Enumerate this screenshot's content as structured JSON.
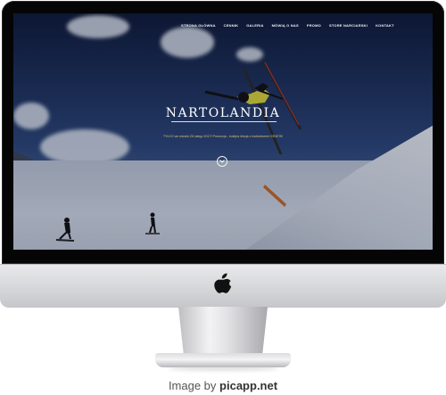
{
  "website": {
    "nav": [
      "STRONA GŁÓWNA",
      "CENNIK",
      "GALERIA",
      "MÓWIĄ O NAS",
      "PROMO",
      "STORE NARCIARSKI",
      "KONTAKT"
    ],
    "title": "NARTOLANDIA",
    "tagline": "TYLKO we wtorek 26 lutego 2017! Promocja - kolejna lekcja z instruktorem GRATIS!"
  },
  "credit": {
    "prefix": "Image by",
    "brand": "picapp.net"
  },
  "icons": {
    "brand_logo": "apple-logo-icon",
    "scroll": "chevron-down-icon"
  },
  "colors": {
    "bezel": "#050505",
    "tagline": "#d9c26a",
    "stand": "#d4d5d8"
  }
}
